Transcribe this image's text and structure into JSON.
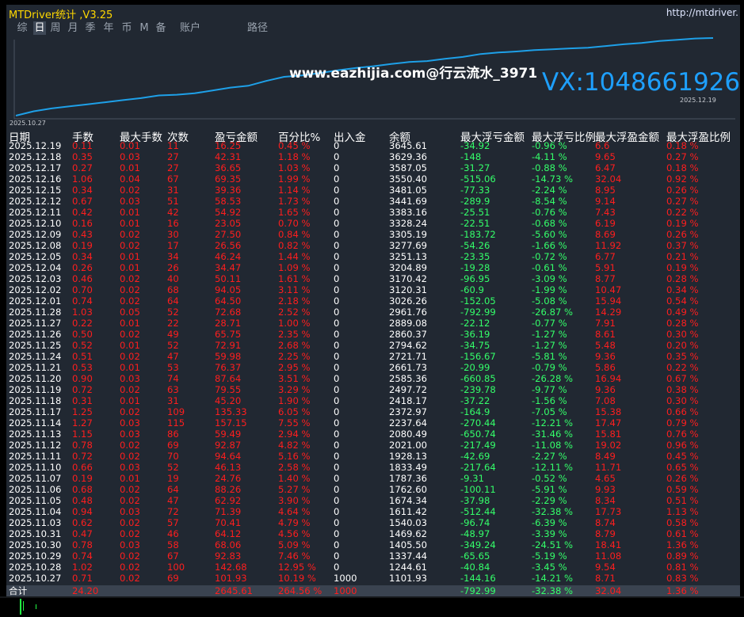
{
  "window": {
    "title": "MTDriver统计 ,V3.25",
    "site": "http://mtdriver."
  },
  "tabs": [
    "综",
    "日",
    "周",
    "月",
    "季",
    "年",
    "币",
    "M",
    "备",
    "账户",
    "路径"
  ],
  "active_tab": "日",
  "chart": {
    "start_label": "2025.10.27",
    "end_label": "2025.12.19",
    "line_color": "#1ea0e8",
    "balances": [
      1101.93,
      1244.61,
      1337.44,
      1405.5,
      1469.62,
      1540.03,
      1611.42,
      1674.34,
      1762.6,
      1787.36,
      1833.49,
      1928.13,
      2021.0,
      2080.49,
      2237.64,
      2372.97,
      2418.17,
      2497.72,
      2585.36,
      2661.73,
      2721.71,
      2794.62,
      2860.37,
      2889.08,
      2961.76,
      3026.26,
      3120.31,
      3170.42,
      3204.89,
      3251.13,
      3277.69,
      3305.19,
      3328.24,
      3383.16,
      3441.69,
      3481.05,
      3550.4,
      3587.05,
      3629.36,
      3645.61
    ]
  },
  "watermark": {
    "line1": "www.eazhijia.com@行云流水_3971",
    "line2": "VX:1048661926"
  },
  "headers": [
    "日期",
    "手数",
    "最大手数",
    "次数",
    "盈亏金额",
    "百分比%",
    "出入金",
    "余额",
    "最大浮亏金额",
    "最大浮亏比例",
    "最大浮盈金额",
    "最大浮盈比例"
  ],
  "rows": [
    [
      "2025.12.19",
      "0.11",
      "0.01",
      "11",
      "16.25",
      "0.45 %",
      "0",
      "3645.61",
      "-34.92",
      "-0.96 %",
      "6.6",
      "0.18 %"
    ],
    [
      "2025.12.18",
      "0.35",
      "0.03",
      "27",
      "42.31",
      "1.18 %",
      "0",
      "3629.36",
      "-148",
      "-4.11 %",
      "9.65",
      "0.27 %"
    ],
    [
      "2025.12.17",
      "0.27",
      "0.01",
      "27",
      "36.65",
      "1.03 %",
      "0",
      "3587.05",
      "-31.27",
      "-0.88 %",
      "6.47",
      "0.18 %"
    ],
    [
      "2025.12.16",
      "1.06",
      "0.04",
      "67",
      "69.35",
      "1.99 %",
      "0",
      "3550.40",
      "-515.06",
      "-14.73 %",
      "32.04",
      "0.92 %"
    ],
    [
      "2025.12.15",
      "0.34",
      "0.02",
      "31",
      "39.36",
      "1.14 %",
      "0",
      "3481.05",
      "-77.33",
      "-2.24 %",
      "8.95",
      "0.26 %"
    ],
    [
      "2025.12.12",
      "0.67",
      "0.03",
      "51",
      "58.53",
      "1.73 %",
      "0",
      "3441.69",
      "-289.9",
      "-8.54 %",
      "9.14",
      "0.27 %"
    ],
    [
      "2025.12.11",
      "0.42",
      "0.01",
      "42",
      "54.92",
      "1.65 %",
      "0",
      "3383.16",
      "-25.51",
      "-0.76 %",
      "7.43",
      "0.22 %"
    ],
    [
      "2025.12.10",
      "0.16",
      "0.01",
      "16",
      "23.05",
      "0.70 %",
      "0",
      "3328.24",
      "-22.51",
      "-0.68 %",
      "6.19",
      "0.19 %"
    ],
    [
      "2025.12.09",
      "0.43",
      "0.02",
      "30",
      "27.50",
      "0.84 %",
      "0",
      "3305.19",
      "-183.72",
      "-5.60 %",
      "8.69",
      "0.26 %"
    ],
    [
      "2025.12.08",
      "0.19",
      "0.02",
      "17",
      "26.56",
      "0.82 %",
      "0",
      "3277.69",
      "-54.26",
      "-1.66 %",
      "11.92",
      "0.37 %"
    ],
    [
      "2025.12.05",
      "0.34",
      "0.01",
      "34",
      "46.24",
      "1.44 %",
      "0",
      "3251.13",
      "-23.35",
      "-0.72 %",
      "6.77",
      "0.21 %"
    ],
    [
      "2025.12.04",
      "0.26",
      "0.01",
      "26",
      "34.47",
      "1.09 %",
      "0",
      "3204.89",
      "-19.28",
      "-0.61 %",
      "5.91",
      "0.19 %"
    ],
    [
      "2025.12.03",
      "0.46",
      "0.02",
      "40",
      "50.11",
      "1.61 %",
      "0",
      "3170.42",
      "-96.95",
      "-3.09 %",
      "8.77",
      "0.28 %"
    ],
    [
      "2025.12.02",
      "0.70",
      "0.02",
      "68",
      "94.05",
      "3.11 %",
      "0",
      "3120.31",
      "-60.9",
      "-1.99 %",
      "10.47",
      "0.34 %"
    ],
    [
      "2025.12.01",
      "0.74",
      "0.02",
      "64",
      "64.50",
      "2.18 %",
      "0",
      "3026.26",
      "-152.05",
      "-5.08 %",
      "15.94",
      "0.54 %"
    ],
    [
      "2025.11.28",
      "1.03",
      "0.05",
      "52",
      "72.68",
      "2.52 %",
      "0",
      "2961.76",
      "-792.99",
      "-26.87 %",
      "14.29",
      "0.49 %"
    ],
    [
      "2025.11.27",
      "0.22",
      "0.01",
      "22",
      "28.71",
      "1.00 %",
      "0",
      "2889.08",
      "-22.12",
      "-0.77 %",
      "7.91",
      "0.28 %"
    ],
    [
      "2025.11.26",
      "0.50",
      "0.02",
      "49",
      "65.75",
      "2.35 %",
      "0",
      "2860.37",
      "-36.19",
      "-1.27 %",
      "8.61",
      "0.30 %"
    ],
    [
      "2025.11.25",
      "0.52",
      "0.01",
      "52",
      "72.91",
      "2.68 %",
      "0",
      "2794.62",
      "-34.75",
      "-1.27 %",
      "5.48",
      "0.20 %"
    ],
    [
      "2025.11.24",
      "0.51",
      "0.02",
      "47",
      "59.98",
      "2.25 %",
      "0",
      "2721.71",
      "-156.67",
      "-5.81 %",
      "9.36",
      "0.35 %"
    ],
    [
      "2025.11.21",
      "0.53",
      "0.01",
      "53",
      "76.37",
      "2.95 %",
      "0",
      "2661.73",
      "-20.99",
      "-0.79 %",
      "5.86",
      "0.22 %"
    ],
    [
      "2025.11.20",
      "0.90",
      "0.03",
      "74",
      "87.64",
      "3.51 %",
      "0",
      "2585.36",
      "-660.85",
      "-26.28 %",
      "16.94",
      "0.67 %"
    ],
    [
      "2025.11.19",
      "0.72",
      "0.02",
      "63",
      "79.55",
      "3.29 %",
      "0",
      "2497.72",
      "-239.78",
      "-9.77 %",
      "9.36",
      "0.38 %"
    ],
    [
      "2025.11.18",
      "0.31",
      "0.01",
      "31",
      "45.20",
      "1.90 %",
      "0",
      "2418.17",
      "-37.22",
      "-1.56 %",
      "7.08",
      "0.30 %"
    ],
    [
      "2025.11.17",
      "1.25",
      "0.02",
      "109",
      "135.33",
      "6.05 %",
      "0",
      "2372.97",
      "-164.9",
      "-7.05 %",
      "15.38",
      "0.66 %"
    ],
    [
      "2025.11.14",
      "1.27",
      "0.03",
      "115",
      "157.15",
      "7.55 %",
      "0",
      "2237.64",
      "-270.44",
      "-12.21 %",
      "17.47",
      "0.79 %"
    ],
    [
      "2025.11.13",
      "1.15",
      "0.03",
      "86",
      "59.49",
      "2.94 %",
      "0",
      "2080.49",
      "-650.74",
      "-31.46 %",
      "15.81",
      "0.76 %"
    ],
    [
      "2025.11.12",
      "0.78",
      "0.02",
      "69",
      "92.87",
      "4.82 %",
      "0",
      "2021.00",
      "-217.49",
      "-11.08 %",
      "19.02",
      "0.96 %"
    ],
    [
      "2025.11.11",
      "0.72",
      "0.02",
      "70",
      "94.64",
      "5.16 %",
      "0",
      "1928.13",
      "-42.69",
      "-2.27 %",
      "8.49",
      "0.45 %"
    ],
    [
      "2025.11.10",
      "0.66",
      "0.03",
      "52",
      "46.13",
      "2.58 %",
      "0",
      "1833.49",
      "-217.64",
      "-12.11 %",
      "11.71",
      "0.65 %"
    ],
    [
      "2025.11.07",
      "0.19",
      "0.01",
      "19",
      "24.76",
      "1.40 %",
      "0",
      "1787.36",
      "-9.31",
      "-0.52 %",
      "4.65",
      "0.26 %"
    ],
    [
      "2025.11.06",
      "0.68",
      "0.02",
      "64",
      "88.26",
      "5.27 %",
      "0",
      "1762.60",
      "-100.11",
      "-5.91 %",
      "9.93",
      "0.59 %"
    ],
    [
      "2025.11.05",
      "0.48",
      "0.02",
      "47",
      "62.92",
      "3.90 %",
      "0",
      "1674.34",
      "-37.98",
      "-2.29 %",
      "8.34",
      "0.51 %"
    ],
    [
      "2025.11.04",
      "0.94",
      "0.03",
      "72",
      "71.39",
      "4.64 %",
      "0",
      "1611.42",
      "-512.44",
      "-32.38 %",
      "17.73",
      "1.13 %"
    ],
    [
      "2025.11.03",
      "0.62",
      "0.02",
      "57",
      "70.41",
      "4.79 %",
      "0",
      "1540.03",
      "-96.74",
      "-6.39 %",
      "8.74",
      "0.58 %"
    ],
    [
      "2025.10.31",
      "0.47",
      "0.02",
      "46",
      "64.12",
      "4.56 %",
      "0",
      "1469.62",
      "-48.97",
      "-3.39 %",
      "8.79",
      "0.61 %"
    ],
    [
      "2025.10.30",
      "0.78",
      "0.03",
      "58",
      "68.06",
      "5.09 %",
      "0",
      "1405.50",
      "-349.24",
      "-24.51 %",
      "18.41",
      "1.36 %"
    ],
    [
      "2025.10.29",
      "0.74",
      "0.02",
      "67",
      "92.83",
      "7.46 %",
      "0",
      "1337.44",
      "-65.65",
      "-5.19 %",
      "11.08",
      "0.89 %"
    ],
    [
      "2025.10.28",
      "1.02",
      "0.02",
      "100",
      "142.68",
      "12.95 %",
      "0",
      "1244.61",
      "-40.84",
      "-3.45 %",
      "9.54",
      "0.81 %"
    ],
    [
      "2025.10.27",
      "0.71",
      "0.02",
      "69",
      "101.93",
      "10.19 %",
      "1000",
      "1101.93",
      "-144.16",
      "-14.21 %",
      "8.71",
      "0.83 %"
    ]
  ],
  "total": {
    "label": "合计",
    "lots": "24.20",
    "pl": "2645.61",
    "pct": "264.56 %",
    "io": "1000",
    "mfl": "-792.99",
    "mflp": "-32.38 %",
    "mfp": "32.04",
    "mfpp": "1.36 %"
  }
}
